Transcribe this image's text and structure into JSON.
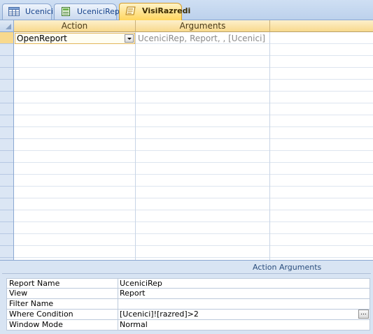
{
  "tabs": [
    {
      "label": "Ucenici",
      "icon": "table-icon",
      "active": false
    },
    {
      "label": "UceniciRep",
      "icon": "report-icon",
      "active": false
    },
    {
      "label": "VisiRazredi",
      "icon": "macro-icon",
      "active": true
    }
  ],
  "grid": {
    "columns": {
      "action": "Action",
      "arguments": "Arguments"
    },
    "rows": [
      {
        "action": "OpenReport",
        "arguments": "UceniciRep, Report, , [Ucenici]"
      }
    ]
  },
  "action_arguments": {
    "title": "Action Arguments",
    "fields": [
      {
        "label": "Report Name",
        "value": "UceniciRep"
      },
      {
        "label": "View",
        "value": "Report"
      },
      {
        "label": "Filter Name",
        "value": ""
      },
      {
        "label": "Where Condition",
        "value": "[Ucenici]![razred]>2",
        "builder_button": "..."
      },
      {
        "label": "Window Mode",
        "value": "Normal"
      }
    ]
  },
  "colors": {
    "active_tab": "#ffd65e",
    "header": "#f8d98d",
    "pane": "#d8e4f3"
  }
}
